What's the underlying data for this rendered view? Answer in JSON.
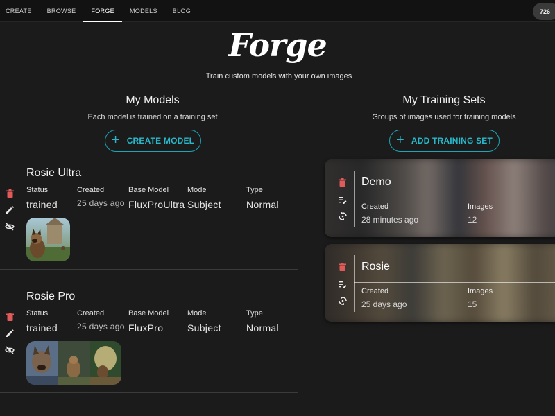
{
  "nav": {
    "items": [
      {
        "label": "CREATE"
      },
      {
        "label": "BROWSE"
      },
      {
        "label": "FORGE"
      },
      {
        "label": "MODELS"
      },
      {
        "label": "BLOG"
      }
    ],
    "active": "FORGE",
    "counter": "726"
  },
  "hero": {
    "logo": "Forge",
    "tagline": "Train custom models with your own images"
  },
  "models_section": {
    "title": "My Models",
    "subtitle": "Each model is trained on a training set",
    "button_label": "CREATE MODEL",
    "field_labels": {
      "status": "Status",
      "created": "Created",
      "base_model": "Base Model",
      "mode": "Mode",
      "type": "Type"
    },
    "models": [
      {
        "name": "Rosie Ultra",
        "status": "trained",
        "created": "25 days ago",
        "base_model": "FluxProUltra",
        "mode": "Subject",
        "type": "Normal"
      },
      {
        "name": "Rosie Pro",
        "status": "trained",
        "created": "25 days ago",
        "base_model": "FluxPro",
        "mode": "Subject",
        "type": "Normal"
      }
    ]
  },
  "training_section": {
    "title": "My Training Sets",
    "subtitle": "Groups of images used for training models",
    "button_label": "ADD TRAINING SET",
    "field_labels": {
      "created": "Created",
      "images": "Images"
    },
    "sets": [
      {
        "name": "Demo",
        "created": "28 minutes ago",
        "images": "12"
      },
      {
        "name": "Rosie",
        "created": "25 days ago",
        "images": "15"
      }
    ]
  },
  "colors": {
    "background": "#1b1b1b",
    "accent": "#27b9cb",
    "delete_icon": "#e05a5a"
  },
  "icons": [
    "trash-icon",
    "pencil-icon",
    "eye-off-icon",
    "edit-list-icon",
    "sync-icon",
    "plus-icon"
  ]
}
